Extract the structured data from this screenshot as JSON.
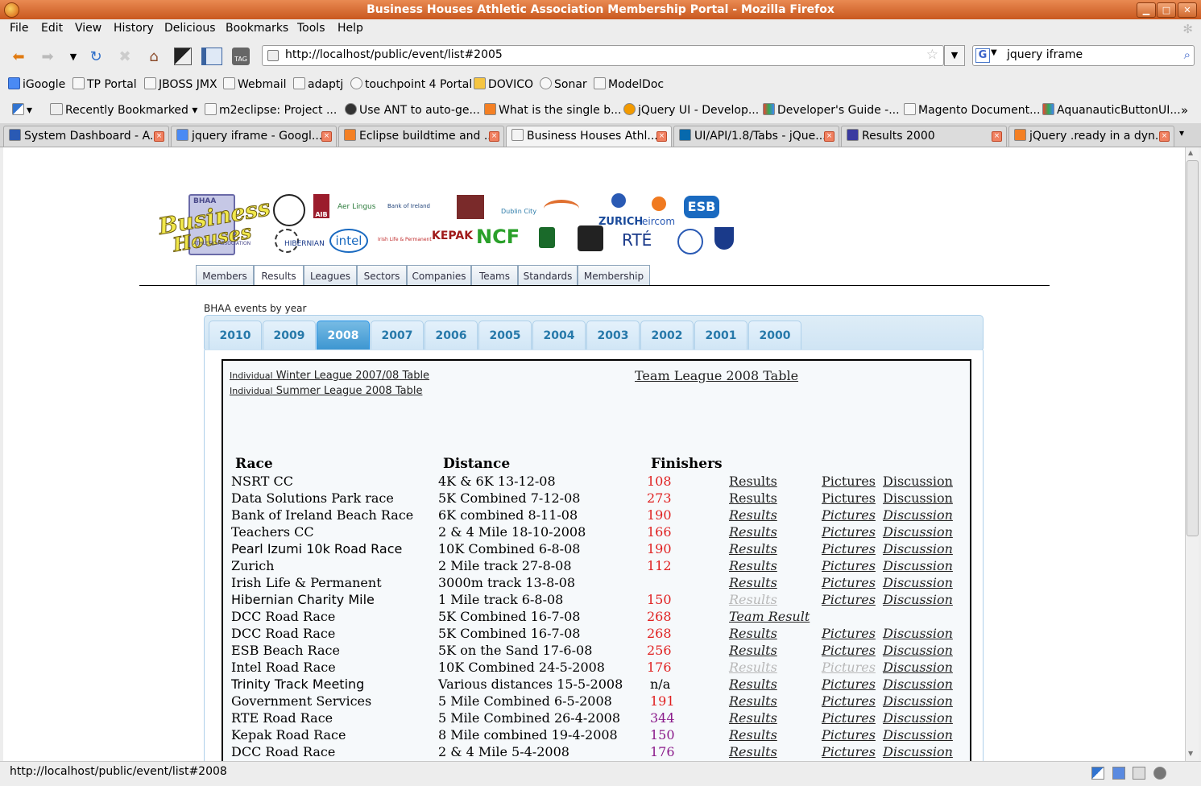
{
  "window": {
    "title": "Business Houses Athletic Association Membership Portal - Mozilla Firefox"
  },
  "menu": [
    "File",
    "Edit",
    "View",
    "History",
    "Delicious",
    "Bookmarks",
    "Tools",
    "Help"
  ],
  "nav": {
    "url": "http://localhost/public/event/list#2005",
    "search": "jquery iframe",
    "tag_label": "TAG"
  },
  "bookmarks": [
    "iGoogle",
    "TP Portal",
    "JBOSS JMX",
    "Webmail",
    "adaptj",
    "touchpoint 4 Portal",
    "DOVICO",
    "Sonar",
    "ModelDoc"
  ],
  "bookmarks2": [
    "Recently Bookmarked",
    "m2eclipse: Project ...",
    "Use ANT to auto-ge...",
    "What is the single b...",
    "jQuery UI - Develop...",
    "Developer's Guide -...",
    "Magento Document...",
    "AquanauticButtonUI..."
  ],
  "more_chevron": "»",
  "tabs": [
    "System Dashboard - A...",
    "jquery iframe - Googl...",
    "Eclipse buildtime and ...",
    "Business Houses Athl...",
    "UI/API/1.8/Tabs - jQue...",
    "Results 2000",
    "jQuery .ready in a dyn..."
  ],
  "status": {
    "text": "http://localhost/public/event/list#2008"
  },
  "logo": {
    "line1": "Business",
    "line2": "Houses",
    "badge": "BHAA",
    "sub": "ATHLETIC ASSOCIATION"
  },
  "sponsors": [
    "AIB",
    "Aer Lingus",
    "Bank of Ireland",
    "Dublin City",
    "ZURICH",
    "eircom",
    "ESB",
    "HIBERNIAN",
    "intel",
    "Irish Life & Permanent",
    "KEPAK",
    "NCF",
    "RTÉ"
  ],
  "site_nav": [
    "Members",
    "Results",
    "Leagues",
    "Sectors",
    "Companies",
    "Teams",
    "Standards",
    "Membership"
  ],
  "events": {
    "caption": "BHAA events by year",
    "years": [
      "2010",
      "2009",
      "2008",
      "2007",
      "2006",
      "2005",
      "2004",
      "2003",
      "2002",
      "2001",
      "2000"
    ],
    "active_year": "2008",
    "links": {
      "winter_a": "Individual",
      "winter_b": " Winter League 2007/08 Table",
      "summer_a": "Individual",
      "summer_b": " Summer League 2008 Table",
      "team": "Team League 2008 Table"
    },
    "headers": {
      "race": "Race",
      "distance": "Distance",
      "finishers": "Finishers"
    },
    "rows": [
      {
        "race": "NSRT CC",
        "distance": "4K & 6K 13-12-08",
        "finishers": "108",
        "results": "Results",
        "pictures": "Pictures",
        "discussion": "Discussion"
      },
      {
        "race": "Data Solutions Park race",
        "distance": "5K Combined 7-12-08",
        "finishers": "273",
        "results": "Results",
        "pictures": "Pictures",
        "discussion": "Discussion"
      },
      {
        "race": "Bank of Ireland Beach Race",
        "distance": "6K combined 8-11-08",
        "finishers": "190",
        "results": "Results",
        "pictures": "Pictures",
        "discussion": "Discussion"
      },
      {
        "race": "Teachers CC",
        "distance": "2 & 4 Mile 18-10-2008",
        "finishers": "166",
        "results": "Results",
        "pictures": "Pictures",
        "discussion": "Discussion"
      },
      {
        "race": "Pearl Izumi 10k Road Race",
        "distance": "10K Combined 6-8-08",
        "finishers": "190",
        "results": "Results",
        "pictures": "Pictures",
        "discussion": "Discussion"
      },
      {
        "race": "Zurich",
        "distance": "2 Mile track 27-8-08",
        "finishers": "112",
        "results": "Results",
        "pictures": "Pictures",
        "discussion": "Discussion"
      },
      {
        "race": "Irish Life & Permanent",
        "distance": "3000m track 13-8-08",
        "finishers": "",
        "results": "Results",
        "pictures": "Pictures",
        "discussion": "Discussion"
      },
      {
        "race": "Hibernian Charity Mile",
        "distance": "1 Mile track 6-8-08",
        "finishers": "150",
        "results": "Results",
        "pictures": "Pictures",
        "discussion": "Discussion"
      },
      {
        "race": "DCC Road Race",
        "distance": "5K Combined 16-7-08",
        "finishers": "268",
        "results": "Team Result",
        "pictures": "",
        "discussion": ""
      },
      {
        "race": "DCC Road Race",
        "distance": "5K Combined 16-7-08",
        "finishers": "268",
        "results": "Results",
        "pictures": "Pictures",
        "discussion": "Discussion"
      },
      {
        "race": "ESB Beach Race",
        "distance": "5K on the Sand 17-6-08",
        "finishers": "256",
        "results": "Results",
        "pictures": "Pictures",
        "discussion": "Discussion"
      },
      {
        "race": "Intel Road Race",
        "distance": "10K Combined 24-5-2008",
        "finishers": "176",
        "results": "Results",
        "pictures": "Pictures",
        "discussion": "Discussion"
      },
      {
        "race": "Trinity Track Meeting",
        "distance": "Various distances 15-5-2008",
        "finishers": "n/a",
        "results": "Results",
        "pictures": "Pictures",
        "discussion": "Discussion"
      },
      {
        "race": "Government Services",
        "distance": "5 Mile Combined 6-5-2008",
        "finishers": "191",
        "results": "Results",
        "pictures": "Pictures",
        "discussion": "Discussion"
      },
      {
        "race": "RTE Road Race",
        "distance": "5 Mile Combined 26-4-2008",
        "finishers": "344",
        "results": "Results",
        "pictures": "Pictures",
        "discussion": "Discussion"
      },
      {
        "race": "Kepak Road Race",
        "distance": "8 Mile combined 19-4-2008",
        "finishers": "150",
        "results": "Results",
        "pictures": "Pictures",
        "discussion": "Discussion"
      },
      {
        "race": "DCC Road Race",
        "distance": "2 & 4 Mile 5-4-2008",
        "finishers": "176",
        "results": "Results",
        "pictures": "Pictures",
        "discussion": "Discussion"
      }
    ]
  }
}
